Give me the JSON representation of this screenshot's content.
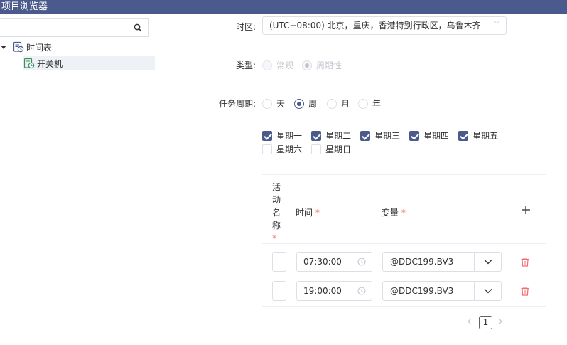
{
  "window": {
    "title": "项目浏览器"
  },
  "left": {
    "search": {
      "value": "",
      "placeholder": ""
    },
    "tree": [
      {
        "label": "时间表",
        "expanded": true
      },
      {
        "label": "开关机",
        "selected": true
      }
    ]
  },
  "form": {
    "timezone": {
      "label": "时区:",
      "value": "(UTC+08:00) 北京，重庆，香港特别行政区，乌鲁木齐"
    },
    "type": {
      "label": "类型:",
      "options": [
        "常规",
        "周期性"
      ],
      "selected": "周期性"
    },
    "period": {
      "label": "任务周期:",
      "options": [
        "天",
        "周",
        "月",
        "年"
      ],
      "selected": "周"
    },
    "weekdays": [
      {
        "label": "星期一",
        "checked": true
      },
      {
        "label": "星期二",
        "checked": true
      },
      {
        "label": "星期三",
        "checked": true
      },
      {
        "label": "星期四",
        "checked": true
      },
      {
        "label": "星期五",
        "checked": true
      },
      {
        "label": "星期六",
        "checked": false
      },
      {
        "label": "星期日",
        "checked": false
      }
    ]
  },
  "table": {
    "headers": {
      "name": [
        "活",
        "动",
        "名",
        "称"
      ],
      "time": "时间",
      "variable": "变量",
      "required": "*"
    },
    "rows": [
      {
        "name": "",
        "time": "07:30:00",
        "variable": "@DDC199.BV3"
      },
      {
        "name": "",
        "time": "19:00:00",
        "variable": "@DDC199.BV3"
      }
    ]
  },
  "pagination": {
    "current": "1"
  },
  "colors": {
    "accent": "#4a5a8c",
    "danger": "#f56c6c",
    "border": "#dcdfe6"
  }
}
